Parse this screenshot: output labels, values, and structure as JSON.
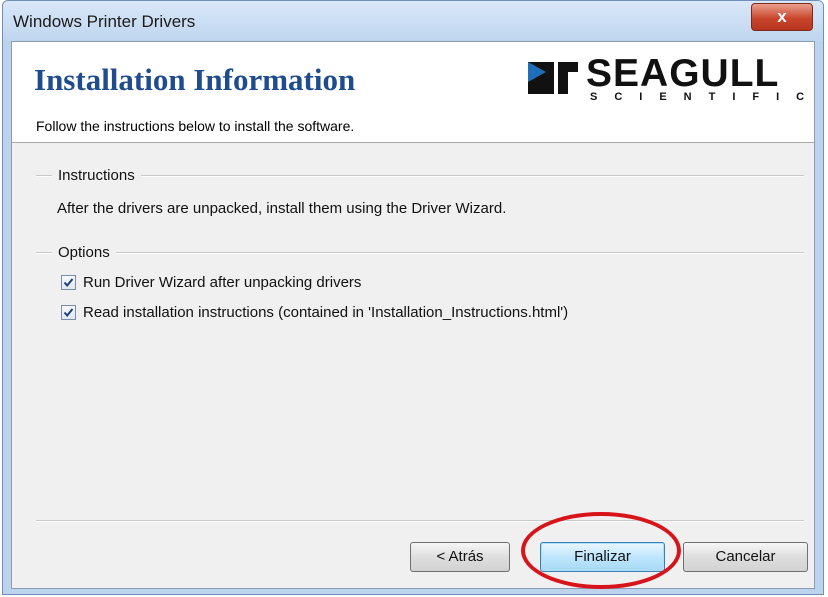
{
  "window": {
    "title": "Windows Printer Drivers",
    "close_glyph": "x"
  },
  "header": {
    "title": "Installation Information",
    "subtitle": "Follow the instructions below to install the software.",
    "logo": {
      "word": "SEAGULL",
      "sub": "SCIENTIFIC",
      "icon": "seagull-logo-icon"
    }
  },
  "instructions": {
    "group_label": "Instructions",
    "text": "After the drivers are unpacked, install them using the Driver Wizard."
  },
  "options": {
    "group_label": "Options",
    "items": [
      {
        "label": "Run Driver Wizard after unpacking drivers",
        "checked": true
      },
      {
        "label": "Read installation instructions (contained in 'Installation_Instructions.html')",
        "checked": true
      }
    ]
  },
  "buttons": {
    "back": "< Atrás",
    "finish": "Finalizar",
    "cancel": "Cancelar"
  },
  "colors": {
    "title_blue": "#1f4c8f",
    "highlight_red": "#d8141b",
    "close_red": "#c9462c"
  }
}
